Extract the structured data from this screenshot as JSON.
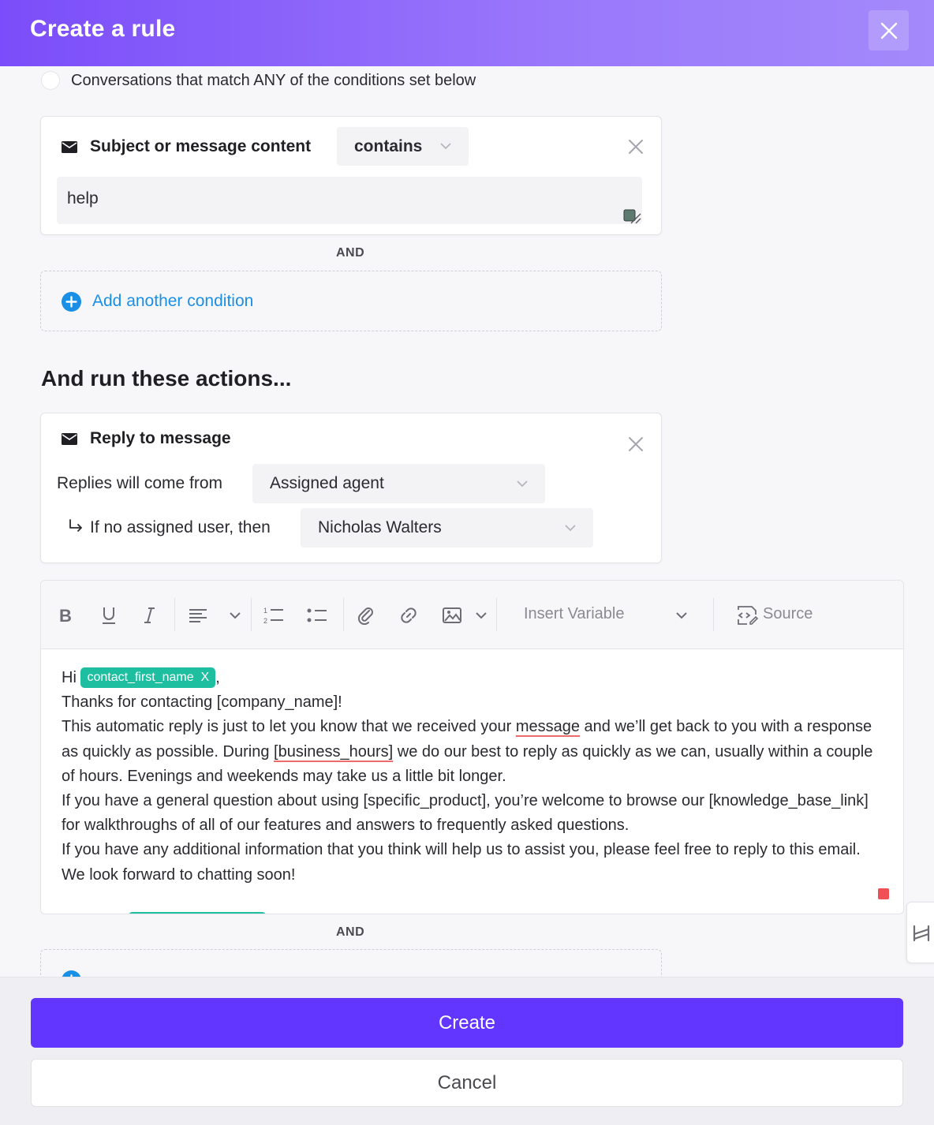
{
  "header": {
    "title": "Create a rule"
  },
  "match": {
    "any_label": "Conversations that match ANY of the conditions set below"
  },
  "condition": {
    "field_label": "Subject or message content",
    "operator": "contains",
    "value": "help"
  },
  "and_label": "AND",
  "add_condition": {
    "label": "Add another condition"
  },
  "actions": {
    "heading": "And run these actions...",
    "reply": {
      "title": "Reply to message",
      "from_label": "Replies will come from",
      "from_value": "Assigned agent",
      "fallback_label": "If no assigned user, then",
      "fallback_value": "Nicholas Walters"
    }
  },
  "editor": {
    "insert_variable": "Insert Variable",
    "source": "Source",
    "greeting": "Hi",
    "variable_chip": "contact_first_name",
    "chip_remove": "X",
    "comma": ",",
    "line2": "Thanks for contacting [company_name]!",
    "line3_a": "This automatic reply is just to let you know that we received your ",
    "line3_word": "message",
    "line3_b": " and we’ll get back to you with a response as quickly as possible. During ",
    "line3_var": "[business_hours]",
    "line3_c": " we do our best to reply as quickly as we can, usually within a couple of hours. Evenings and weekends may take us a little bit longer.",
    "line4": "If you have a general question about using [specific_product], you’re welcome to browse our [knowledge_base_link] for walkthroughs of all of our features and answers to frequently asked questions.",
    "line5": "If you have any additional information that you think will help us to assist you, please feel free to reply to this email.",
    "line6": "We look forward to chatting soon!"
  },
  "footer": {
    "create_label": "Create",
    "cancel_label": "Cancel"
  },
  "colors": {
    "primary": "#6236ff",
    "header_start": "#7b4dfa",
    "link": "#1a8fe6",
    "chip": "#1ebfa0"
  }
}
